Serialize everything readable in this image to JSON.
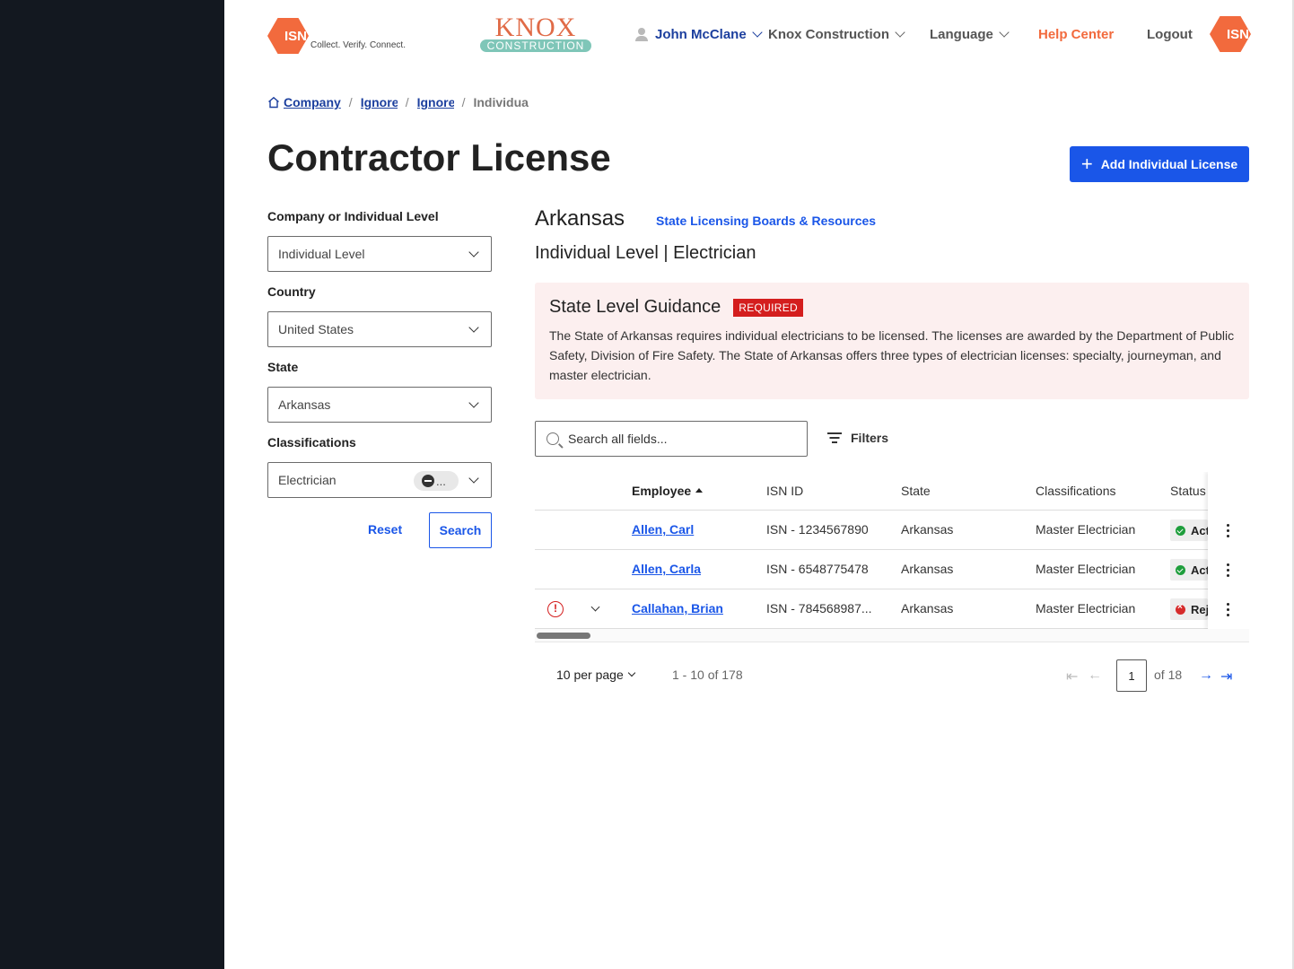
{
  "header": {
    "isn_logo_text": "ISN",
    "isn_tagline": "Collect. Verify. Connect.",
    "knox_word": "KNOX",
    "knox_sub": "CONSTRUCTION",
    "user_name": "John McClane",
    "company": "Knox Construction",
    "language": "Language",
    "help": "Help Center",
    "logout": "Logout",
    "isn_right_text": "ISN"
  },
  "breadcrumb": {
    "home": "Company",
    "item1": "Ignore",
    "item2": "Ignore",
    "current": "Individual"
  },
  "page": {
    "title": "Contractor License",
    "add_button": "Add Individual License"
  },
  "filters": {
    "level_label": "Company or Individual Level",
    "level_value": "Individual Level",
    "country_label": "Country",
    "country_value": "United States",
    "state_label": "State",
    "state_value": "Arkansas",
    "class_label": "Classifications",
    "class_value": "Electrician",
    "class_chip": "...",
    "reset": "Reset",
    "search": "Search"
  },
  "content": {
    "state": "Arkansas",
    "state_link": "State Licensing Boards & Resources",
    "level_line": "Individual Level | Electrician",
    "guidance_title": "State Level Guidance",
    "guidance_badge": "REQUIRED",
    "guidance_text": "The State of Arkansas requires individual electricians to be licensed. The licenses are awarded by the Department of Public Safety, Division of Fire Safety. The State of Arkansas offers three types of electrician licenses: specialty, journeyman, and master electrician.",
    "search_placeholder": "Search all fields...",
    "filters_label": "Filters"
  },
  "table": {
    "columns": [
      "Employee",
      "ISN ID",
      "State",
      "Classifications",
      "Status"
    ],
    "rows": [
      {
        "employee": "Allen, Carl",
        "isn": "ISN - 1234567890",
        "state": "Arkansas",
        "classification": "Master Electrician",
        "status": "Active"
      },
      {
        "employee": "Allen, Carla",
        "isn": "ISN - 6548775478",
        "state": "Arkansas",
        "classification": "Master Electrician",
        "status": "Active"
      },
      {
        "employee": "Callahan, Brian",
        "isn": "ISN - 784568987...",
        "state": "Arkansas",
        "classification": "Master Electrician",
        "status": "Rejected"
      }
    ]
  },
  "pagination": {
    "per_page": "10 per page",
    "range": "1 - 10 of 178",
    "page": "1",
    "of": "of 18"
  },
  "colors": {
    "brand_orange": "#f26a3d",
    "primary_blue": "#1a56e8",
    "nav_dark": "#131820",
    "required_red": "#d41e1e",
    "guidance_bg": "#fcefef"
  }
}
